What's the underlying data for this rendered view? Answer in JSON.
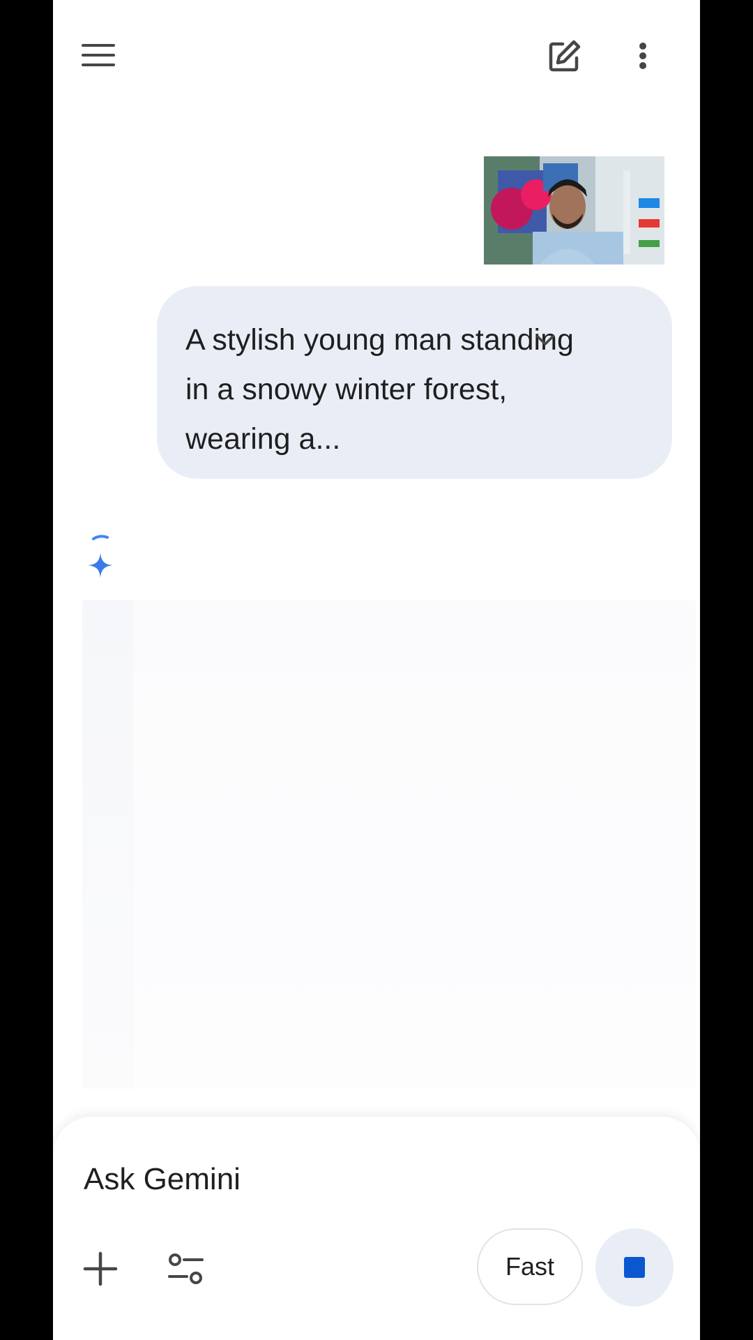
{
  "header": {
    "menu_icon": "hamburger-menu-icon",
    "new_chat_icon": "edit-compose-icon",
    "more_icon": "more-vert-icon"
  },
  "conversation": {
    "attachment": {
      "kind": "photo-thumbnail"
    },
    "prompt": {
      "text": "A stylish young man standing in a snowy winter forest, wearing a...",
      "expand_icon": "chevron-down-icon"
    },
    "response": {
      "state": "loading",
      "icon": "gemini-spark-icon"
    }
  },
  "composer": {
    "placeholder": "Ask Gemini",
    "add_icon": "plus-icon",
    "tools_icon": "tools-icon",
    "mode_label": "Fast",
    "stop_icon": "stop-icon"
  },
  "colors": {
    "bubble": "#e9eef6",
    "accent": "#0b57d0",
    "spark_blue": "#4285f4",
    "text": "#1f1f1f"
  }
}
